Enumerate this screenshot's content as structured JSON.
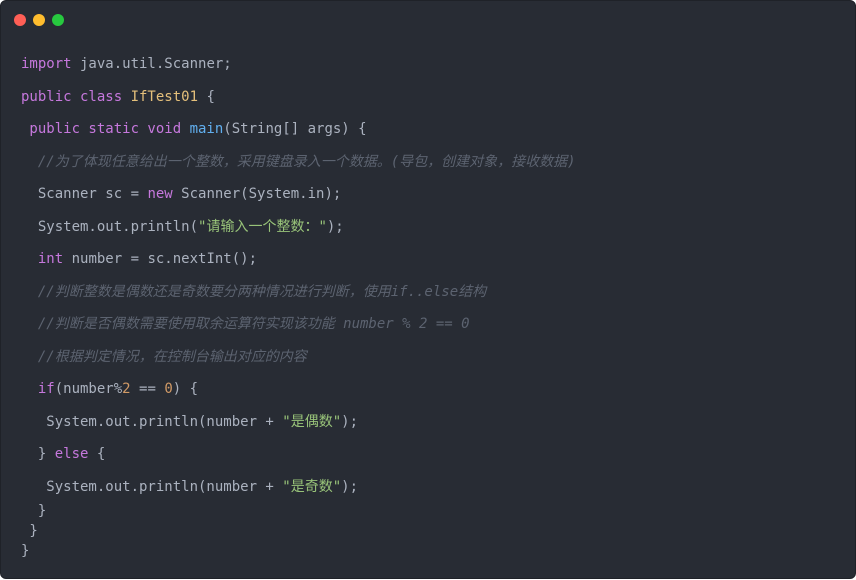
{
  "window": {
    "buttons": [
      {
        "name": "close-dot",
        "color": "#ff5f56"
      },
      {
        "name": "minimize-dot",
        "color": "#ffbd2e"
      },
      {
        "name": "maximize-dot",
        "color": "#27c93f"
      }
    ]
  },
  "colors": {
    "default": "#abb2bf",
    "keyword": "#c678dd",
    "class_name": "#e5c07b",
    "function": "#61afef",
    "string": "#98c379",
    "number": "#d19a66",
    "comment": "#5c6370"
  },
  "code_lines": [
    [
      [
        "import",
        "keyword"
      ],
      [
        " java.util.Scanner;",
        "default"
      ]
    ],
    [
      [
        "public class ",
        "keyword"
      ],
      [
        "IfTest01",
        "class_name"
      ],
      [
        " {",
        "default"
      ]
    ],
    [
      [
        " public static void ",
        "keyword"
      ],
      [
        "main",
        "function"
      ],
      [
        "(String[] args) {",
        "default"
      ]
    ],
    [
      [
        "  //为了体现任意给出一个整数，采用键盘录入一个数据。(导包，创建对象，接收数据)",
        "comment"
      ]
    ],
    [
      [
        "  Scanner sc = ",
        "default"
      ],
      [
        "new",
        "keyword"
      ],
      [
        " Scanner(System.in);",
        "default"
      ]
    ],
    [
      [
        "  System.out.println(",
        "default"
      ],
      [
        "\"请输入一个整数：\"",
        "string"
      ],
      [
        ");",
        "default"
      ]
    ],
    [
      [
        "  ",
        "default"
      ],
      [
        "int",
        "keyword"
      ],
      [
        " number = sc.nextInt();",
        "default"
      ]
    ],
    [
      [
        "  //判断整数是偶数还是奇数要分两种情况进行判断，使用if..else结构",
        "comment"
      ]
    ],
    [
      [
        "  //判断是否偶数需要使用取余运算符实现该功能 number % 2 == 0",
        "comment"
      ]
    ],
    [
      [
        "  //根据判定情况，在控制台输出对应的内容",
        "comment"
      ]
    ],
    [
      [
        "  ",
        "default"
      ],
      [
        "if",
        "keyword"
      ],
      [
        "(number%",
        "default"
      ],
      [
        "2",
        "number"
      ],
      [
        " == ",
        "default"
      ],
      [
        "0",
        "number"
      ],
      [
        ") {",
        "default"
      ]
    ],
    [
      [
        "   System.out.println(number + ",
        "default"
      ],
      [
        "\"是偶数\"",
        "string"
      ],
      [
        ");",
        "default"
      ]
    ],
    [
      [
        "  } ",
        "default"
      ],
      [
        "else",
        "keyword"
      ],
      [
        " {",
        "default"
      ]
    ],
    [
      [
        "   System.out.println(number + ",
        "default"
      ],
      [
        "\"是奇数\"",
        "string"
      ],
      [
        ");",
        "default"
      ]
    ],
    [
      [
        "  }",
        "default"
      ]
    ],
    [
      [
        " }",
        "default"
      ]
    ],
    [
      [
        "}",
        "default"
      ]
    ]
  ]
}
